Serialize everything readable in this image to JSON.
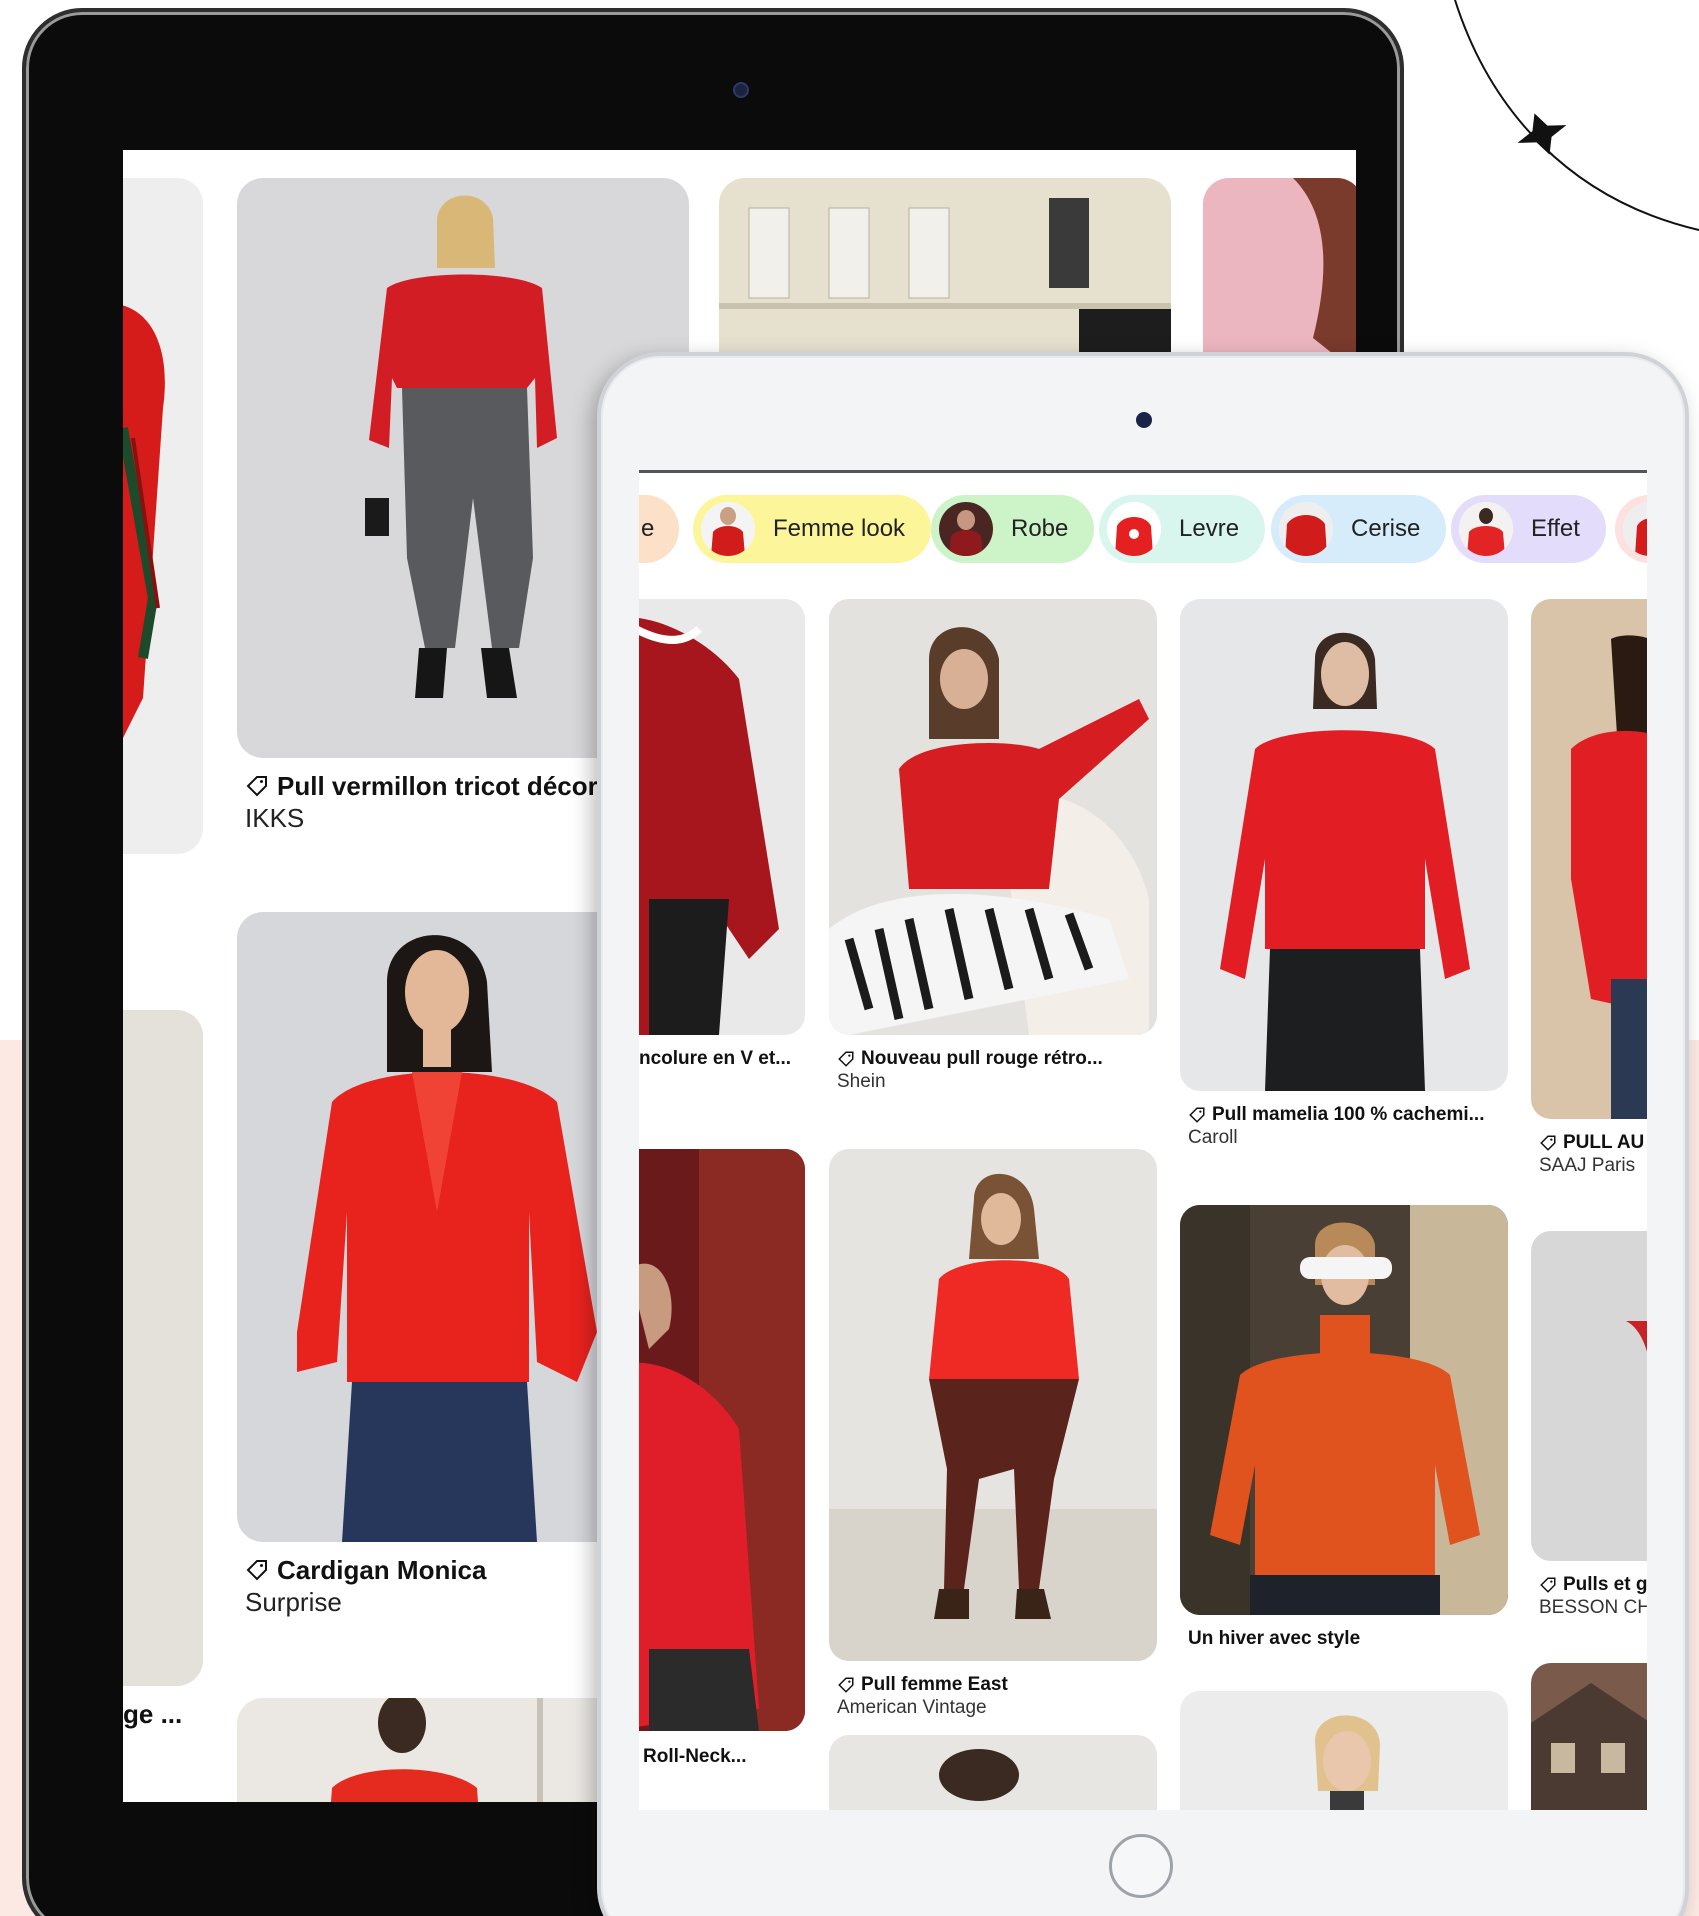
{
  "back_tablet": {
    "pins": [
      {
        "title": "Pull vermillon tricot décor...",
        "source": "IKKS"
      },
      {
        "title": "Cardigan Monica",
        "source": "Surprise"
      },
      {
        "title": "ge ...",
        "source": ""
      }
    ]
  },
  "front_tablet": {
    "chips": [
      {
        "label": "e",
        "color": "#fde0c8"
      },
      {
        "label": "Femme look",
        "color": "#fdf59a"
      },
      {
        "label": "Robe",
        "color": "#cdf3c8"
      },
      {
        "label": "Levre",
        "color": "#d8f6ee"
      },
      {
        "label": "Cerise",
        "color": "#d6ecfb"
      },
      {
        "label": "Effet",
        "color": "#e4dcfb"
      }
    ],
    "pins": [
      {
        "title": "ncolure en V et...",
        "source": ""
      },
      {
        "title": "Nouveau pull rouge rétro...",
        "source": "Shein"
      },
      {
        "title": "Pull mamelia 100 % cachemi...",
        "source": "Caroll"
      },
      {
        "title": "PULL AU",
        "source": "SAAJ Paris"
      },
      {
        "title": "Roll-Neck...",
        "source": ""
      },
      {
        "title": "Pull femme East",
        "source": "American Vintage"
      },
      {
        "title": "Un hiver avec style",
        "source": ""
      },
      {
        "title": "Pulls et g",
        "source": "BESSON CH"
      }
    ]
  },
  "colors": {
    "accent_red": "#d81c1c",
    "orange": "#e04a18",
    "pink_background": "#fde9e4"
  }
}
